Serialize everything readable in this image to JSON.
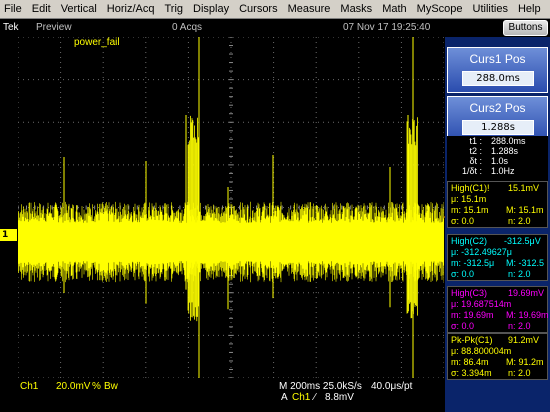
{
  "menu": {
    "items": [
      "File",
      "Edit",
      "Vertical",
      "Horiz/Acq",
      "Trig",
      "Display",
      "Cursors",
      "Measure",
      "Masks",
      "Math",
      "MyScope",
      "Utilities",
      "Help"
    ]
  },
  "status": {
    "brand": "Tek",
    "mode": "Preview",
    "acqs": "0 Acqs",
    "datetime": "07 Nov 17 19:25:40",
    "buttons_label": "Buttons"
  },
  "display": {
    "channel_label": "power_fail",
    "ch1_marker": "1"
  },
  "bottom": {
    "ch": "Ch1",
    "scale": "20.0mV",
    "bw_sym": "%",
    "bw": "Bw",
    "timebase": "M 200ms 25.0kS/s",
    "resolution": "40.0μs/pt",
    "trig_a": "A",
    "trig_ch": "Ch1",
    "trig_slope": "∕",
    "trig_level": "8.8mV"
  },
  "cursors": {
    "curs1_title": "Curs1 Pos",
    "curs1_value": "288.0ms",
    "curs2_title": "Curs2 Pos",
    "curs2_value": "1.288s",
    "readouts": [
      {
        "k": "t1 :",
        "v": "288.0ms"
      },
      {
        "k": "t2 :",
        "v": "1.288s"
      },
      {
        "k": "δt :",
        "v": "1.0s"
      },
      {
        "k": "1/δt :",
        "v": "1.0Hz"
      }
    ]
  },
  "measurements": [
    {
      "title": "High(C1)!",
      "value": "15.1mV",
      "mu": "μ: 15.1m",
      "m": "m: 15.1m",
      "M": "M: 15.1m",
      "sigma": "σ: 0.0",
      "n": "n: 2.0",
      "color": "#ffff00"
    },
    {
      "title": "High(C2)",
      "value": "-312.5μV",
      "mu": "μ: -312.49627μ",
      "m": "m: -312.5μ",
      "M": "M: -312.5",
      "sigma": "σ: 0.0",
      "n": "n: 2.0",
      "color": "#00ffff"
    },
    {
      "title": "High(C3)",
      "value": "19.69mV",
      "mu": "μ: 19.687514m",
      "m": "m: 19.69m",
      "M": "M: 19.69m",
      "sigma": "σ: 0.0",
      "n": "n: 2.0",
      "color": "#ff00ff"
    },
    {
      "title": "Pk-Pk(C1)",
      "value": "91.2mV",
      "mu": "μ: 88.800004m",
      "m": "m: 86.4m",
      "M": "M: 91.2m",
      "sigma": "σ: 3.394m",
      "n": "n: 2.0",
      "color": "#ffff00"
    }
  ],
  "colors": {
    "trace": "#ffff00",
    "grid": "#6a6a6a",
    "cursor": "#ffff00",
    "panel": "#0a246a"
  },
  "cursor_times_s": {
    "t1": 0.288,
    "t2": 1.288
  },
  "icons": {
    "ch1_marker": "channel-1-ground-marker",
    "trigger": "trigger-level-arrow"
  }
}
